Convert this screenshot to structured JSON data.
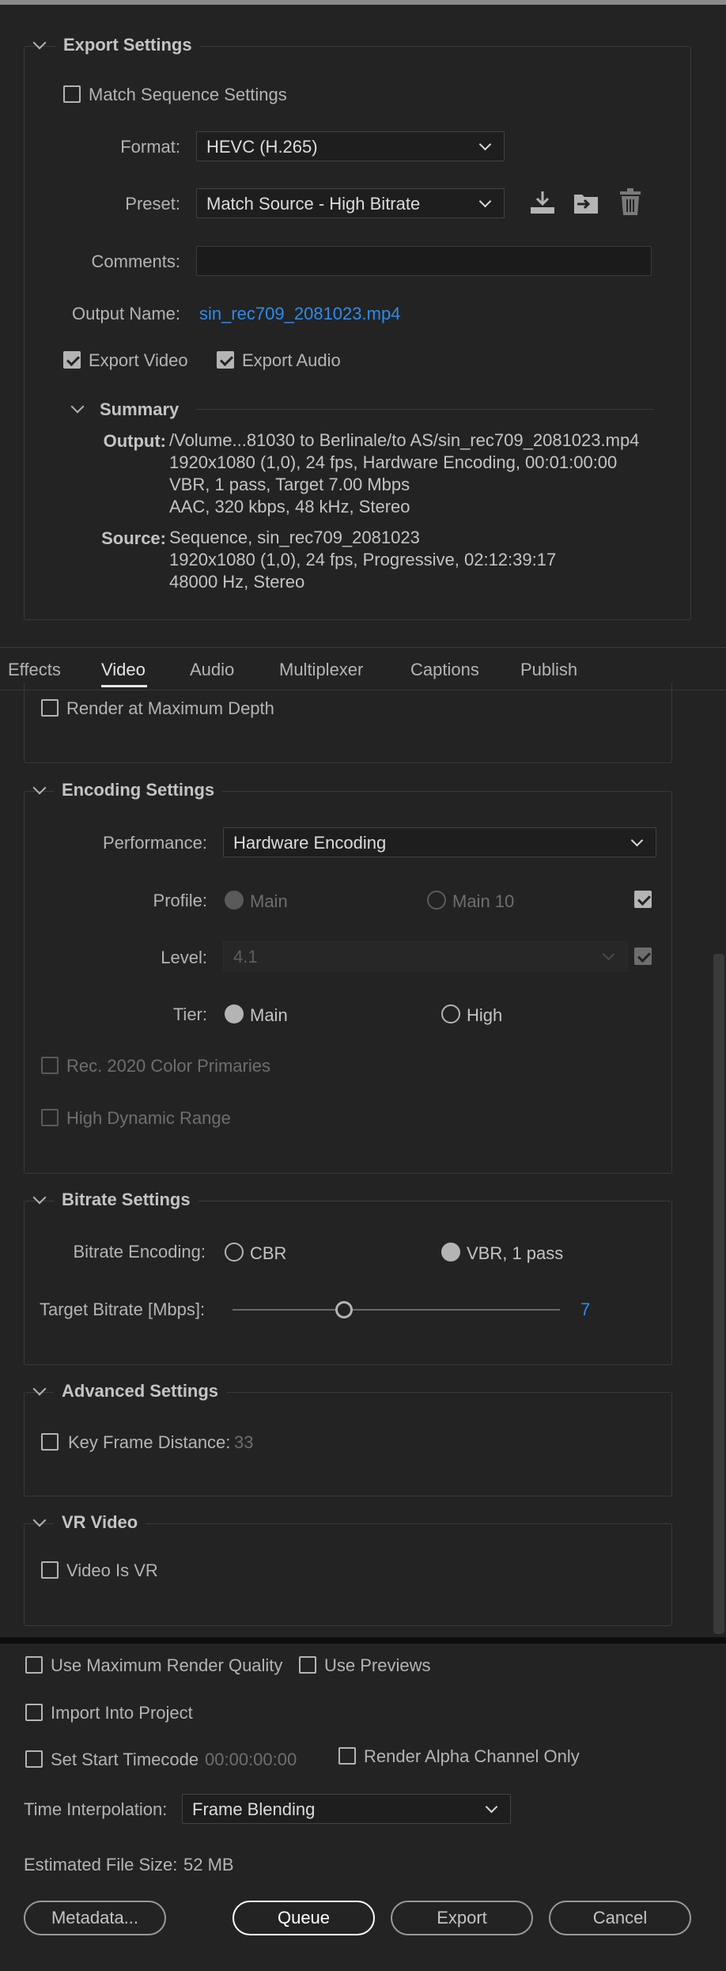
{
  "export_settings": {
    "title": "Export Settings",
    "match_sequence": "Match Sequence Settings",
    "format_label": "Format:",
    "format_value": "HEVC (H.265)",
    "preset_label": "Preset:",
    "preset_value": "Match Source - High Bitrate",
    "comments_label": "Comments:",
    "output_name_label": "Output Name:",
    "output_name_value": "sin_rec709_2081023.mp4",
    "export_video": "Export Video",
    "export_audio": "Export Audio",
    "icons": [
      "save-preset-icon",
      "import-preset-icon",
      "delete-preset-icon"
    ]
  },
  "summary": {
    "title": "Summary",
    "output_label": "Output:",
    "output_lines": [
      "/Volume...81030 to Berlinale/to AS/sin_rec709_2081023.mp4",
      "1920x1080 (1,0), 24 fps, Hardware Encoding, 00:01:00:00",
      "VBR, 1 pass, Target 7.00 Mbps",
      "AAC, 320 kbps, 48 kHz, Stereo"
    ],
    "source_label": "Source:",
    "source_lines": [
      "Sequence, sin_rec709_2081023",
      "1920x1080 (1,0), 24 fps, Progressive, 02:12:39:17",
      "48000 Hz, Stereo"
    ]
  },
  "tabs": [
    "Effects",
    "Video",
    "Audio",
    "Multiplexer",
    "Captions",
    "Publish"
  ],
  "active_tab": "Video",
  "video": {
    "render_max_depth": "Render at Maximum Depth"
  },
  "encoding": {
    "title": "Encoding Settings",
    "performance_label": "Performance:",
    "performance_value": "Hardware Encoding",
    "profile_label": "Profile:",
    "profile_main": "Main",
    "profile_main10": "Main 10",
    "level_label": "Level:",
    "level_value": "4.1",
    "tier_label": "Tier:",
    "tier_main": "Main",
    "tier_high": "High",
    "rec2020": "Rec. 2020 Color Primaries",
    "hdr": "High Dynamic Range"
  },
  "bitrate": {
    "title": "Bitrate Settings",
    "encoding_label": "Bitrate Encoding:",
    "cbr": "CBR",
    "vbr": "VBR, 1 pass",
    "target_label": "Target Bitrate [Mbps]:",
    "target_value": "7",
    "slider_level": 0.34
  },
  "advanced": {
    "title": "Advanced Settings",
    "key_frame_label": "Key Frame Distance:",
    "key_frame_value": "33"
  },
  "vr": {
    "title": "VR Video",
    "is_vr": "Video Is VR"
  },
  "footer": {
    "max_render_quality": "Use Maximum Render Quality",
    "use_previews": "Use Previews",
    "import_into_project": "Import Into Project",
    "set_start_timecode": "Set Start Timecode",
    "timecode_value": "00:00:00:00",
    "render_alpha": "Render Alpha Channel Only",
    "time_interp_label": "Time Interpolation:",
    "time_interp_value": "Frame Blending",
    "est_size_label": "Estimated File Size:",
    "est_size_value": "52 MB",
    "metadata_btn": "Metadata...",
    "queue_btn": "Queue",
    "export_btn": "Export",
    "cancel_btn": "Cancel"
  },
  "colors": {
    "background": "#232323",
    "accent_link": "#2d8ceb",
    "text": "#b4b4b4"
  }
}
